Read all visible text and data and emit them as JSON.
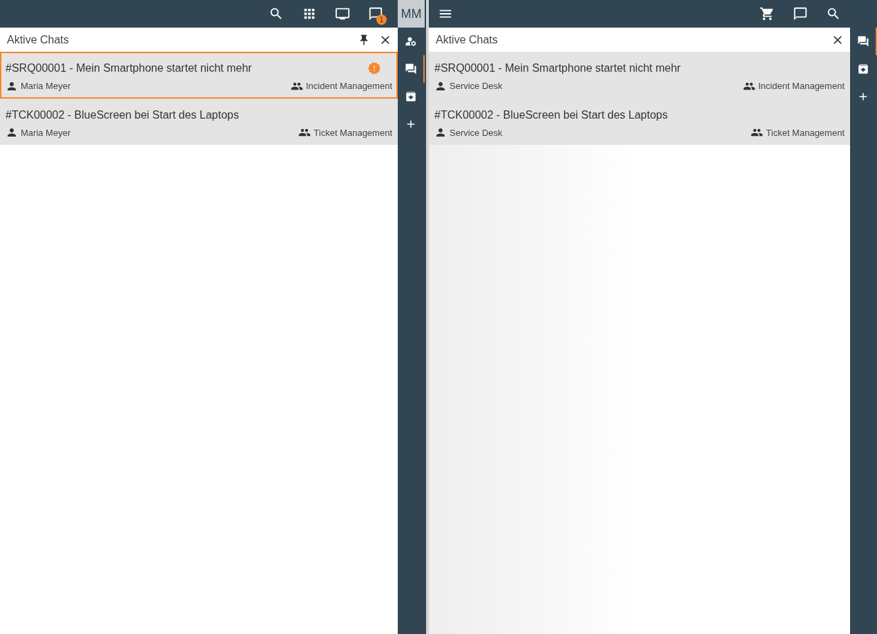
{
  "left_toolbar": {
    "icons": [
      {
        "kind": "search"
      },
      {
        "kind": "apps"
      },
      {
        "kind": "video"
      },
      {
        "kind": "chat",
        "badge": "1"
      }
    ]
  },
  "avatar": "MM",
  "left_panel": {
    "title": "Aktive Chats",
    "chats": [
      {
        "title": "#SRQ00001 - Mein Smartphone startet nicht mehr",
        "person": "Maria Meyer",
        "group": "Incident Management",
        "selected": true,
        "alert": true
      },
      {
        "title": "#TCK00002 - BlueScreen bei Start des Laptops",
        "person": "Maria Meyer",
        "group": "Ticket Management",
        "selected": false,
        "alert": false
      }
    ]
  },
  "left_rail": [
    {
      "kind": "user-settings",
      "selected": false
    },
    {
      "kind": "chats",
      "selected": true
    },
    {
      "kind": "archive",
      "selected": false
    },
    {
      "kind": "add",
      "selected": false
    }
  ],
  "right_toolbar": {
    "icons": [
      {
        "kind": "cart"
      },
      {
        "kind": "chat"
      },
      {
        "kind": "search"
      }
    ]
  },
  "right_panel": {
    "title": "Aktive Chats",
    "chats": [
      {
        "title": "#SRQ00001 - Mein Smartphone startet nicht mehr",
        "person": "Service Desk",
        "group": "Incident Management"
      },
      {
        "title": "#TCK00002 - BlueScreen bei Start des Laptops",
        "person": "Service Desk",
        "group": "Ticket Management"
      }
    ]
  },
  "right_rail": [
    {
      "kind": "chats",
      "selected": true
    },
    {
      "kind": "archive",
      "selected": false
    },
    {
      "kind": "add",
      "selected": false
    }
  ]
}
